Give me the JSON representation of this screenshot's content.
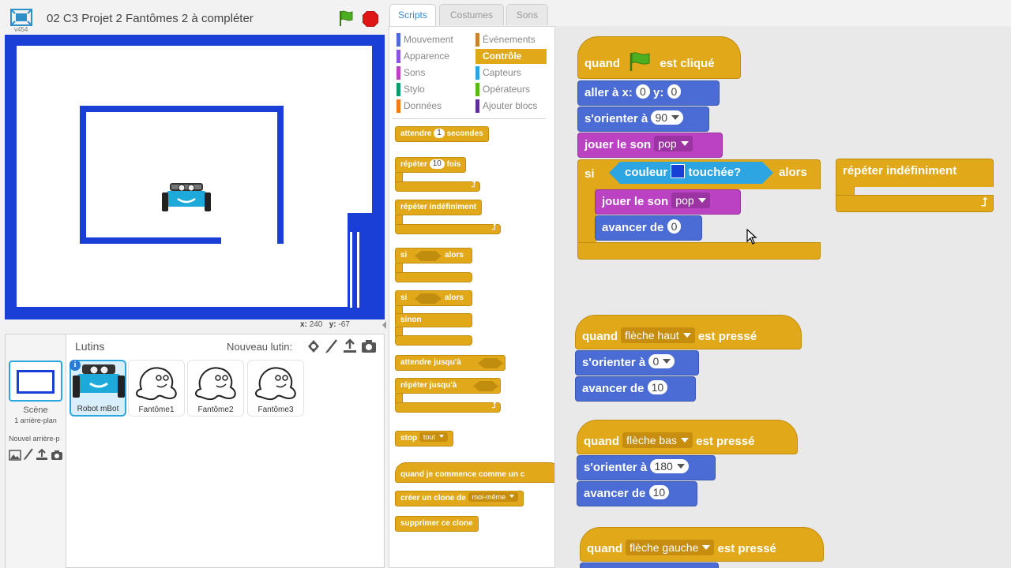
{
  "app": {
    "title": "02 C3 Projet 2 Fantômes 2 à compléter",
    "version": "v454"
  },
  "stage": {
    "x_label": "x:",
    "x_value": "240",
    "y_label": "y:",
    "y_value": "-67"
  },
  "sprites_panel": {
    "title": "Lutins",
    "new_sprite_label": "Nouveau lutin:",
    "scene_label": "Scène",
    "scene_sub": "1 arrière-plan",
    "new_backdrop_label": "Nouvel arrière-p",
    "sprites": [
      {
        "name": "Robot mBot"
      },
      {
        "name": "Fantôme1"
      },
      {
        "name": "Fantôme2"
      },
      {
        "name": "Fantôme3"
      }
    ]
  },
  "tabs": [
    "Scripts",
    "Costumes",
    "Sons"
  ],
  "categories": [
    {
      "label": "Mouvement",
      "color": "#4a6cd4"
    },
    {
      "label": "Événements",
      "color": "#c88330"
    },
    {
      "label": "Apparence",
      "color": "#8a55d7"
    },
    {
      "label": "Contrôle",
      "color": "#e1a91a"
    },
    {
      "label": "Sons",
      "color": "#bb42c3"
    },
    {
      "label": "Capteurs",
      "color": "#2ca5e2"
    },
    {
      "label": "Stylo",
      "color": "#0e9a6c"
    },
    {
      "label": "Opérateurs",
      "color": "#5cb712"
    },
    {
      "label": "Données",
      "color": "#ee7d16"
    },
    {
      "label": "Ajouter blocs",
      "color": "#632d99"
    }
  ],
  "palette_blocks": {
    "wait_pre": "attendre",
    "wait_num": "1",
    "wait_post": "secondes",
    "repeat_pre": "répéter",
    "repeat_num": "10",
    "repeat_post": "fois",
    "forever": "répéter indéfiniment",
    "if1": "si",
    "then1": "alors",
    "if2": "si",
    "then2": "alors",
    "else": "sinon",
    "wait_until": "attendre jusqu'à",
    "repeat_until": "répéter jusqu'à",
    "stop": "stop",
    "stop_opt": "tout",
    "clone_start": "quand je commence comme un c",
    "create_clone": "créer un clone de",
    "create_clone_opt": "moi-même",
    "delete_clone": "supprimer ce clone"
  },
  "scripts": {
    "s1": {
      "hat_pre": "quand",
      "hat_post": "est cliqué",
      "goto_label": "aller à x:",
      "goto_x": "0",
      "goto_y_label": "y:",
      "goto_y": "0",
      "point_label": "s'orienter à",
      "point_val": "90",
      "play1_label": "jouer le son",
      "play1_val": "pop",
      "if_label": "si",
      "cond_pre": "couleur",
      "cond_post": "touchée?",
      "then_label": "alors",
      "play2_label": "jouer le son",
      "play2_val": "pop",
      "move_label": "avancer de",
      "move_val": "0"
    },
    "forever_block": "répéter indéfiniment",
    "s2": {
      "pre": "quand",
      "key": "flèche haut",
      "post": "est pressé",
      "point_label": "s'orienter à",
      "point_val": "0",
      "move_label": "avancer de",
      "move_val": "10"
    },
    "s3": {
      "pre": "quand",
      "key": "flèche bas",
      "post": "est pressé",
      "point_label": "s'orienter à",
      "point_val": "180",
      "move_label": "avancer de",
      "move_val": "10"
    },
    "s4": {
      "pre": "quand",
      "key": "flèche gauche",
      "post": "est pressé"
    }
  }
}
